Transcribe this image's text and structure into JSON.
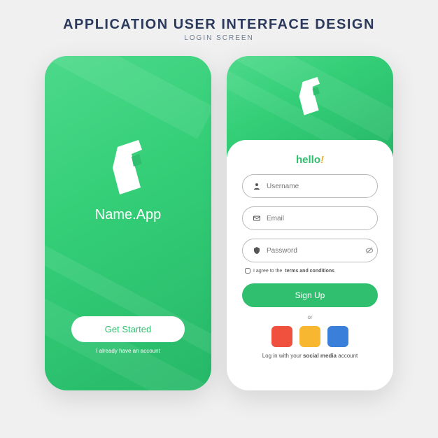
{
  "header": {
    "title": "APPLICATION USER INTERFACE DESIGN",
    "subtitle": "LOGIN SCREEN"
  },
  "splash": {
    "app_name": "Name.App",
    "get_started": "Get Started",
    "already": "I already have an account"
  },
  "login": {
    "hello": "hello",
    "exclaim": "!",
    "username_ph": "Username",
    "email_ph": "Email",
    "password_ph": "Password",
    "terms_prefix": "I agree to the ",
    "terms_link": "terms and conditions",
    "signup": "Sign Up",
    "or": "or",
    "social_prefix": "Log in with your ",
    "social_bold": "social media",
    "social_suffix": " account"
  },
  "colors": {
    "primary": "#2fbf6f",
    "accent": "#f2b233",
    "social_red": "#f0503e",
    "social_yellow": "#f7b731",
    "social_blue": "#3a7fda"
  }
}
